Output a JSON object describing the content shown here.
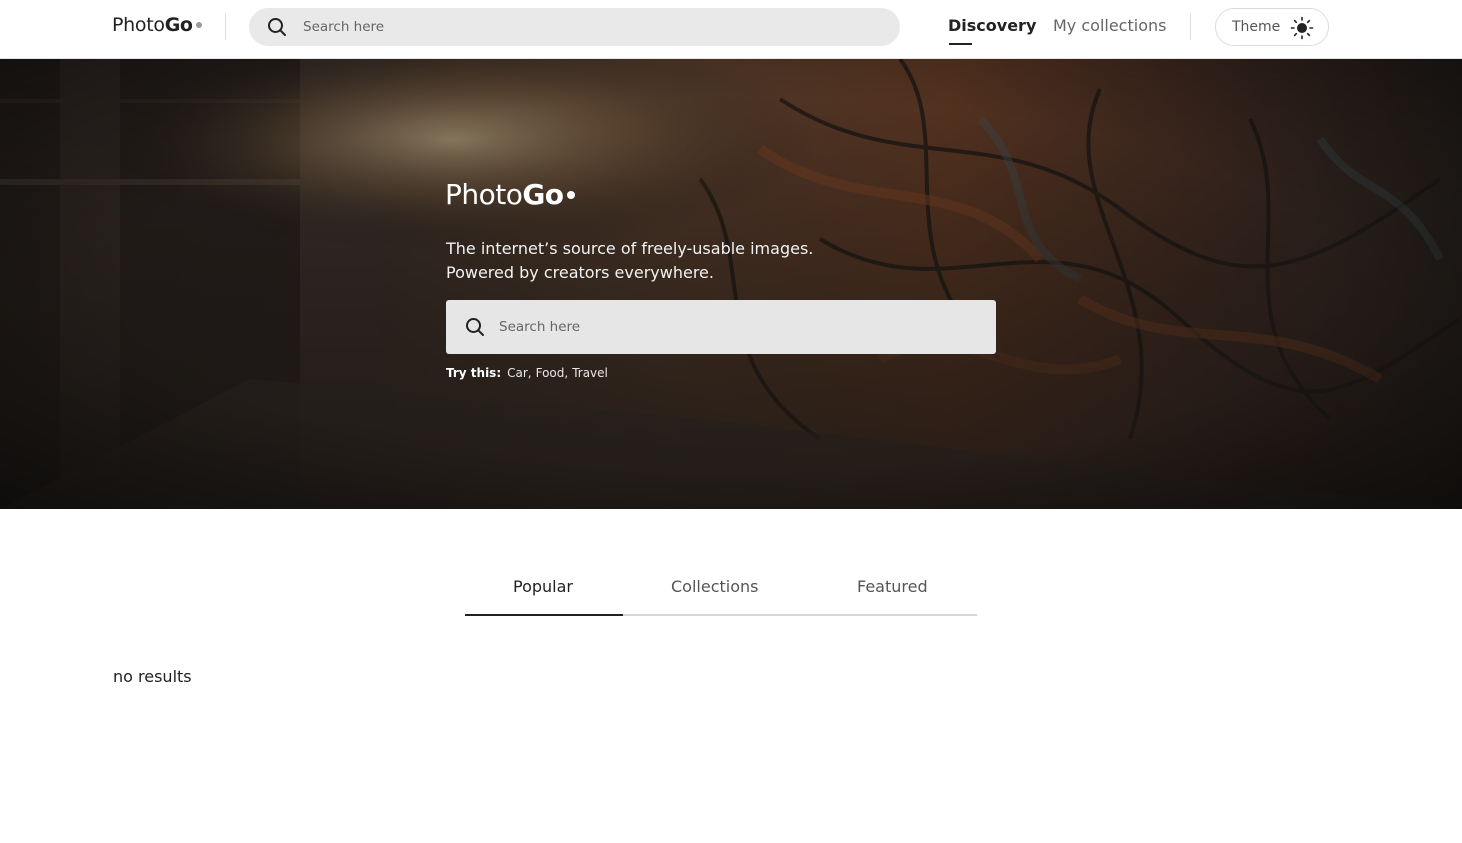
{
  "header": {
    "logo": {
      "light": "Photo",
      "bold": "Go"
    },
    "search": {
      "placeholder": "Search here"
    },
    "nav": [
      {
        "label": "Discovery",
        "active": true
      },
      {
        "label": "My collections",
        "active": false
      }
    ],
    "theme": {
      "label": "Theme",
      "icon": "sun-icon"
    }
  },
  "hero": {
    "logo": {
      "light": "Photo",
      "bold": "Go"
    },
    "tagline_line1": "The internet’s source of freely-usable images.",
    "tagline_line2": "Powered by creators everywhere.",
    "search": {
      "placeholder": "Search here"
    },
    "try_label": "Try this:",
    "suggestions": [
      "Car,",
      "Food,",
      "Travel"
    ]
  },
  "tabs": [
    {
      "label": "Popular",
      "active": true
    },
    {
      "label": "Collections",
      "active": false
    },
    {
      "label": "Featured",
      "active": false
    }
  ],
  "results": {
    "empty_text": "no results"
  },
  "colors": {
    "accent": "#222222",
    "search_bg": "#e9e9e9",
    "hero_overlay": "#1e1a17"
  }
}
